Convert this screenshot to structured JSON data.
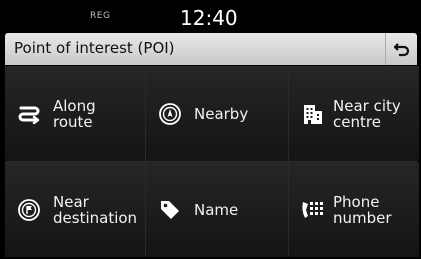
{
  "status": {
    "reg": "REG",
    "time": "12:40"
  },
  "header": {
    "title": "Point of interest (POI)"
  },
  "menu": [
    {
      "label": "Along\nroute",
      "icon": "route-icon"
    },
    {
      "label": "Nearby",
      "icon": "nearby-compass-icon"
    },
    {
      "label": "Near city\ncentre",
      "icon": "city-building-icon"
    },
    {
      "label": "Near\ndestination",
      "icon": "destination-flag-icon"
    },
    {
      "label": "Name",
      "icon": "tag-icon"
    },
    {
      "label": "Phone\nnumber",
      "icon": "phone-keypad-icon"
    }
  ]
}
